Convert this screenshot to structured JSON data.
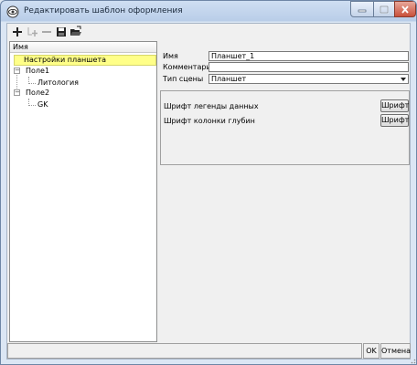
{
  "window": {
    "title": "Редактировать шаблон оформления"
  },
  "toolbar": {
    "buttons": [
      {
        "icon": "plus-icon"
      },
      {
        "icon": "add-child-icon"
      },
      {
        "icon": "minus-icon"
      },
      {
        "icon": "save-icon"
      },
      {
        "icon": "open-folder-icon"
      }
    ]
  },
  "tree": {
    "header": "Имя",
    "items": [
      {
        "label": "Настройки планшета",
        "selected": true
      },
      {
        "label": "Поле1",
        "expander": "−"
      },
      {
        "label": "Литология"
      },
      {
        "label": "Поле2",
        "expander": "−"
      },
      {
        "label": "GK"
      }
    ]
  },
  "properties": {
    "name_label": "Имя",
    "name_value": "Планшет_1",
    "comment_label": "Комментарий",
    "comment_value": "",
    "scene_type_label": "Тип сцены",
    "scene_type_value": "Планшет"
  },
  "fonts": {
    "legend_label": "Шрифт легенды данных",
    "legend_button": "Шрифт",
    "depth_label": "Шрифт колонки глубин",
    "depth_button": "Шрифт"
  },
  "footer": {
    "ok_label": "OK",
    "cancel_label": "Отмена"
  }
}
